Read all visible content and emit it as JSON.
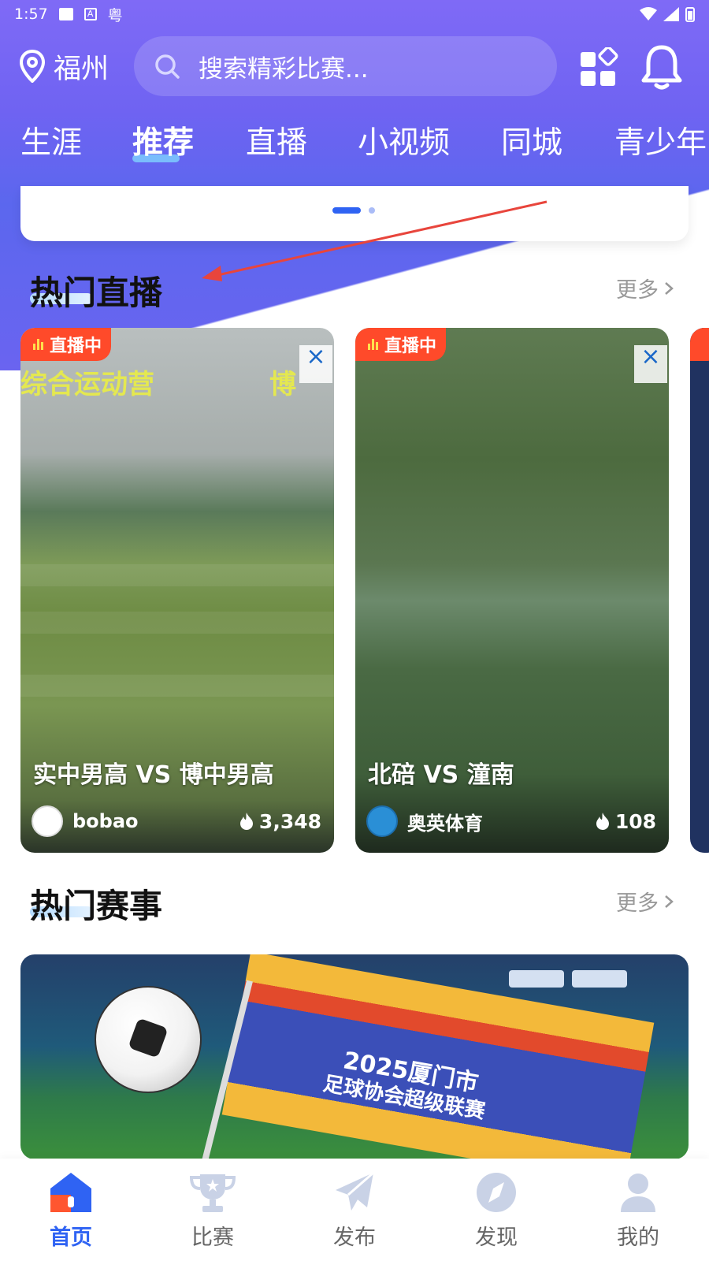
{
  "status_bar": {
    "time": "1:57",
    "icons": [
      "image-icon",
      "a-icon",
      "粤"
    ],
    "right_icons": [
      "wifi-icon",
      "signal-icon",
      "battery-icon"
    ]
  },
  "header": {
    "city": "福州",
    "search_placeholder": "搜索精彩比赛...",
    "icons": [
      "apps-icon",
      "bell-icon"
    ]
  },
  "tabs": [
    {
      "label": "生涯",
      "active": false
    },
    {
      "label": "推荐",
      "active": true
    },
    {
      "label": "直播",
      "active": false
    },
    {
      "label": "小视频",
      "active": false
    },
    {
      "label": "同城",
      "active": false
    },
    {
      "label": "青少年",
      "active": false
    }
  ],
  "hot_live": {
    "title": "热门直播",
    "more": "更多",
    "cards": [
      {
        "badge": "直播中",
        "overlay_left": "综合运动营",
        "overlay_right": "博",
        "title": "实中男高 VS 博中男高",
        "author": "bobao",
        "heat": "3,348"
      },
      {
        "badge": "直播中",
        "title": "北碚 VS 潼南",
        "author": "奥英体育",
        "heat": "108"
      }
    ]
  },
  "hot_events": {
    "title": "热门赛事",
    "more": "更多",
    "banner_line1": "2025厦门市",
    "banner_line2": "足球协会超级联赛"
  },
  "bottom_nav": [
    {
      "label": "首页",
      "icon": "home-icon",
      "active": true
    },
    {
      "label": "比赛",
      "icon": "trophy-icon",
      "active": false
    },
    {
      "label": "发布",
      "icon": "send-icon",
      "active": false
    },
    {
      "label": "发现",
      "icon": "compass-icon",
      "active": false
    },
    {
      "label": "我的",
      "icon": "user-icon",
      "active": false
    }
  ],
  "colors": {
    "accent": "#2f63f3",
    "header_gradient": "#6f63f2",
    "live_badge": "#ff4a2a"
  }
}
